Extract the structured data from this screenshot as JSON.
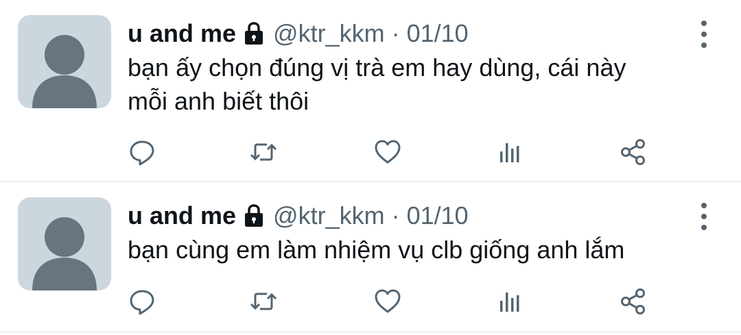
{
  "colors": {
    "text_primary": "#0f1419",
    "text_secondary": "#536471",
    "avatar_bg": "#ccd6dd",
    "avatar_fg": "#66757f",
    "divider": "#eceff1"
  },
  "tweets": [
    {
      "author_name": "u and me",
      "protected": true,
      "handle": "@ktr_kkm",
      "separator": "·",
      "date": "01/10",
      "text_lines": [
        "bạn ấy chọn đúng vị trà em hay dùng, cái này",
        "mỗi anh biết thôi"
      ],
      "actions": [
        "reply-icon",
        "retweet-icon",
        "like-icon",
        "analytics-icon",
        "share-icon"
      ]
    },
    {
      "author_name": "u and me",
      "protected": true,
      "handle": "@ktr_kkm",
      "separator": "·",
      "date": "01/10",
      "text_lines": [
        "bạn cùng em làm nhiệm vụ clb giống anh lắm"
      ],
      "actions": [
        "reply-icon",
        "retweet-icon",
        "like-icon",
        "analytics-icon",
        "share-icon"
      ]
    }
  ]
}
